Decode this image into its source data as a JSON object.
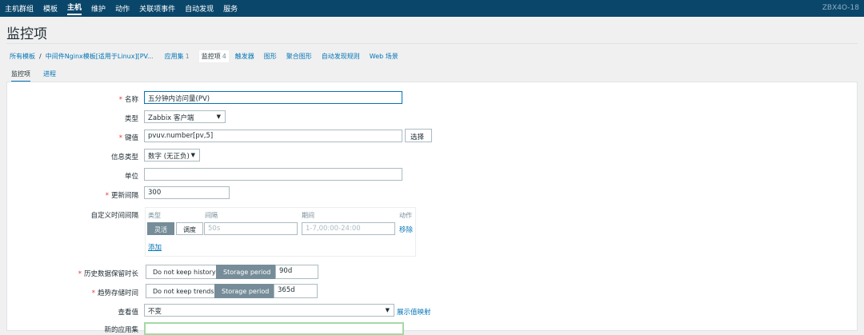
{
  "nav": {
    "items": [
      "主机群组",
      "模板",
      "主机",
      "维护",
      "动作",
      "关联项事件",
      "自动发现",
      "服务"
    ],
    "active_index": 2,
    "server_name": "ZBX4O-18"
  },
  "page_title": "监控项",
  "breadcrumbs": {
    "all_templates": "所有模板",
    "separator": "/",
    "template_name": "中间件Nginx模板[适用于Linux][PV...",
    "items": [
      {
        "label": "应用集",
        "count": "1"
      },
      {
        "label": "监控项",
        "count": "4"
      },
      {
        "label": "触发器",
        "count": ""
      },
      {
        "label": "图形",
        "count": ""
      },
      {
        "label": "聚合图形",
        "count": ""
      },
      {
        "label": "自动发现规则",
        "count": ""
      },
      {
        "label": "Web 场景",
        "count": ""
      }
    ]
  },
  "tabs": [
    "监控项",
    "进程"
  ],
  "form": {
    "name": {
      "label": "名称",
      "value": "五分钟内访问量(PV)"
    },
    "type": {
      "label": "类型",
      "value": "Zabbix 客户端"
    },
    "key": {
      "label": "键值",
      "value": "pvuv.number[pv,5]",
      "button": "选择"
    },
    "info_type": {
      "label": "信息类型",
      "value": "数字 (无正负)"
    },
    "units": {
      "label": "单位",
      "value": ""
    },
    "update_interval": {
      "label": "更新间隔",
      "value": "300"
    },
    "custom_intervals": {
      "label": "自定义时间间隔",
      "headers": {
        "type": "类型",
        "interval": "间隔",
        "period": "期间",
        "action": "动作"
      },
      "type_options": [
        "灵活",
        "调度"
      ],
      "active_option": "灵活",
      "interval_placeholder": "50s",
      "period_placeholder": "1-7,00:00-24:00",
      "remove": "移除",
      "add": "添加"
    },
    "history": {
      "label": "历史数据保留时长",
      "options": [
        "Do not keep history",
        "Storage period"
      ],
      "active": "Storage period",
      "value": "90d"
    },
    "trends": {
      "label": "趋势存储时间",
      "options": [
        "Do not keep trends",
        "Storage period"
      ],
      "active": "Storage period",
      "value": "365d"
    },
    "value_map": {
      "label": "查看值",
      "value": "不变",
      "link": "展示值映射"
    },
    "new_app": {
      "label": "新的应用集",
      "value": ""
    }
  },
  "colors": {
    "header_bg": "#0a466a",
    "link": "#0275b8",
    "required": "#e33734",
    "segment_on": "#768d99"
  }
}
